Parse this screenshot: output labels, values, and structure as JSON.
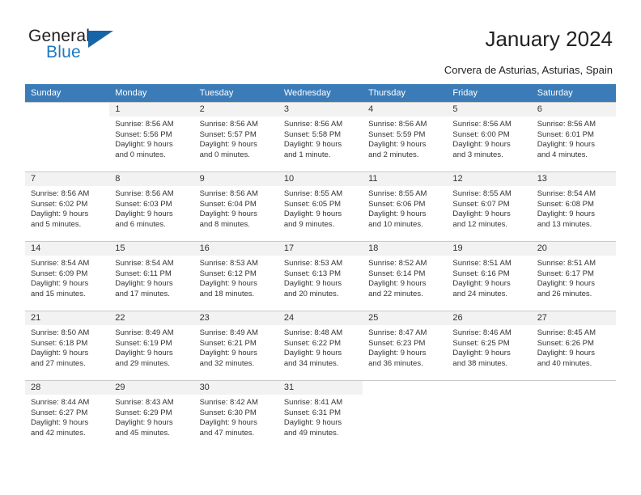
{
  "brand": {
    "name_top": "General",
    "name_bottom": "Blue",
    "triangle_icon": "triangle-icon",
    "color_dark": "#231f20",
    "color_blue": "#1f78c1"
  },
  "header": {
    "title": "January 2024",
    "subtitle": "Corvera de Asturias, Asturias, Spain"
  },
  "calendar": {
    "accent_color": "#3b7cb8",
    "weekday_headers": [
      "Sunday",
      "Monday",
      "Tuesday",
      "Wednesday",
      "Thursday",
      "Friday",
      "Saturday"
    ],
    "weeks": [
      [
        {
          "day": "",
          "blank": true,
          "sunrise": "",
          "sunset": "",
          "daylight1": "",
          "daylight2": ""
        },
        {
          "day": "1",
          "sunrise": "Sunrise: 8:56 AM",
          "sunset": "Sunset: 5:56 PM",
          "daylight1": "Daylight: 9 hours",
          "daylight2": "and 0 minutes."
        },
        {
          "day": "2",
          "sunrise": "Sunrise: 8:56 AM",
          "sunset": "Sunset: 5:57 PM",
          "daylight1": "Daylight: 9 hours",
          "daylight2": "and 0 minutes."
        },
        {
          "day": "3",
          "sunrise": "Sunrise: 8:56 AM",
          "sunset": "Sunset: 5:58 PM",
          "daylight1": "Daylight: 9 hours",
          "daylight2": "and 1 minute."
        },
        {
          "day": "4",
          "sunrise": "Sunrise: 8:56 AM",
          "sunset": "Sunset: 5:59 PM",
          "daylight1": "Daylight: 9 hours",
          "daylight2": "and 2 minutes."
        },
        {
          "day": "5",
          "sunrise": "Sunrise: 8:56 AM",
          "sunset": "Sunset: 6:00 PM",
          "daylight1": "Daylight: 9 hours",
          "daylight2": "and 3 minutes."
        },
        {
          "day": "6",
          "sunrise": "Sunrise: 8:56 AM",
          "sunset": "Sunset: 6:01 PM",
          "daylight1": "Daylight: 9 hours",
          "daylight2": "and 4 minutes."
        }
      ],
      [
        {
          "day": "7",
          "sunrise": "Sunrise: 8:56 AM",
          "sunset": "Sunset: 6:02 PM",
          "daylight1": "Daylight: 9 hours",
          "daylight2": "and 5 minutes."
        },
        {
          "day": "8",
          "sunrise": "Sunrise: 8:56 AM",
          "sunset": "Sunset: 6:03 PM",
          "daylight1": "Daylight: 9 hours",
          "daylight2": "and 6 minutes."
        },
        {
          "day": "9",
          "sunrise": "Sunrise: 8:56 AM",
          "sunset": "Sunset: 6:04 PM",
          "daylight1": "Daylight: 9 hours",
          "daylight2": "and 8 minutes."
        },
        {
          "day": "10",
          "sunrise": "Sunrise: 8:55 AM",
          "sunset": "Sunset: 6:05 PM",
          "daylight1": "Daylight: 9 hours",
          "daylight2": "and 9 minutes."
        },
        {
          "day": "11",
          "sunrise": "Sunrise: 8:55 AM",
          "sunset": "Sunset: 6:06 PM",
          "daylight1": "Daylight: 9 hours",
          "daylight2": "and 10 minutes."
        },
        {
          "day": "12",
          "sunrise": "Sunrise: 8:55 AM",
          "sunset": "Sunset: 6:07 PM",
          "daylight1": "Daylight: 9 hours",
          "daylight2": "and 12 minutes."
        },
        {
          "day": "13",
          "sunrise": "Sunrise: 8:54 AM",
          "sunset": "Sunset: 6:08 PM",
          "daylight1": "Daylight: 9 hours",
          "daylight2": "and 13 minutes."
        }
      ],
      [
        {
          "day": "14",
          "sunrise": "Sunrise: 8:54 AM",
          "sunset": "Sunset: 6:09 PM",
          "daylight1": "Daylight: 9 hours",
          "daylight2": "and 15 minutes."
        },
        {
          "day": "15",
          "sunrise": "Sunrise: 8:54 AM",
          "sunset": "Sunset: 6:11 PM",
          "daylight1": "Daylight: 9 hours",
          "daylight2": "and 17 minutes."
        },
        {
          "day": "16",
          "sunrise": "Sunrise: 8:53 AM",
          "sunset": "Sunset: 6:12 PM",
          "daylight1": "Daylight: 9 hours",
          "daylight2": "and 18 minutes."
        },
        {
          "day": "17",
          "sunrise": "Sunrise: 8:53 AM",
          "sunset": "Sunset: 6:13 PM",
          "daylight1": "Daylight: 9 hours",
          "daylight2": "and 20 minutes."
        },
        {
          "day": "18",
          "sunrise": "Sunrise: 8:52 AM",
          "sunset": "Sunset: 6:14 PM",
          "daylight1": "Daylight: 9 hours",
          "daylight2": "and 22 minutes."
        },
        {
          "day": "19",
          "sunrise": "Sunrise: 8:51 AM",
          "sunset": "Sunset: 6:16 PM",
          "daylight1": "Daylight: 9 hours",
          "daylight2": "and 24 minutes."
        },
        {
          "day": "20",
          "sunrise": "Sunrise: 8:51 AM",
          "sunset": "Sunset: 6:17 PM",
          "daylight1": "Daylight: 9 hours",
          "daylight2": "and 26 minutes."
        }
      ],
      [
        {
          "day": "21",
          "sunrise": "Sunrise: 8:50 AM",
          "sunset": "Sunset: 6:18 PM",
          "daylight1": "Daylight: 9 hours",
          "daylight2": "and 27 minutes."
        },
        {
          "day": "22",
          "sunrise": "Sunrise: 8:49 AM",
          "sunset": "Sunset: 6:19 PM",
          "daylight1": "Daylight: 9 hours",
          "daylight2": "and 29 minutes."
        },
        {
          "day": "23",
          "sunrise": "Sunrise: 8:49 AM",
          "sunset": "Sunset: 6:21 PM",
          "daylight1": "Daylight: 9 hours",
          "daylight2": "and 32 minutes."
        },
        {
          "day": "24",
          "sunrise": "Sunrise: 8:48 AM",
          "sunset": "Sunset: 6:22 PM",
          "daylight1": "Daylight: 9 hours",
          "daylight2": "and 34 minutes."
        },
        {
          "day": "25",
          "sunrise": "Sunrise: 8:47 AM",
          "sunset": "Sunset: 6:23 PM",
          "daylight1": "Daylight: 9 hours",
          "daylight2": "and 36 minutes."
        },
        {
          "day": "26",
          "sunrise": "Sunrise: 8:46 AM",
          "sunset": "Sunset: 6:25 PM",
          "daylight1": "Daylight: 9 hours",
          "daylight2": "and 38 minutes."
        },
        {
          "day": "27",
          "sunrise": "Sunrise: 8:45 AM",
          "sunset": "Sunset: 6:26 PM",
          "daylight1": "Daylight: 9 hours",
          "daylight2": "and 40 minutes."
        }
      ],
      [
        {
          "day": "28",
          "sunrise": "Sunrise: 8:44 AM",
          "sunset": "Sunset: 6:27 PM",
          "daylight1": "Daylight: 9 hours",
          "daylight2": "and 42 minutes."
        },
        {
          "day": "29",
          "sunrise": "Sunrise: 8:43 AM",
          "sunset": "Sunset: 6:29 PM",
          "daylight1": "Daylight: 9 hours",
          "daylight2": "and 45 minutes."
        },
        {
          "day": "30",
          "sunrise": "Sunrise: 8:42 AM",
          "sunset": "Sunset: 6:30 PM",
          "daylight1": "Daylight: 9 hours",
          "daylight2": "and 47 minutes."
        },
        {
          "day": "31",
          "sunrise": "Sunrise: 8:41 AM",
          "sunset": "Sunset: 6:31 PM",
          "daylight1": "Daylight: 9 hours",
          "daylight2": "and 49 minutes."
        },
        {
          "day": "",
          "blank": true,
          "sunrise": "",
          "sunset": "",
          "daylight1": "",
          "daylight2": ""
        },
        {
          "day": "",
          "blank": true,
          "sunrise": "",
          "sunset": "",
          "daylight1": "",
          "daylight2": ""
        },
        {
          "day": "",
          "blank": true,
          "sunrise": "",
          "sunset": "",
          "daylight1": "",
          "daylight2": ""
        }
      ]
    ]
  }
}
